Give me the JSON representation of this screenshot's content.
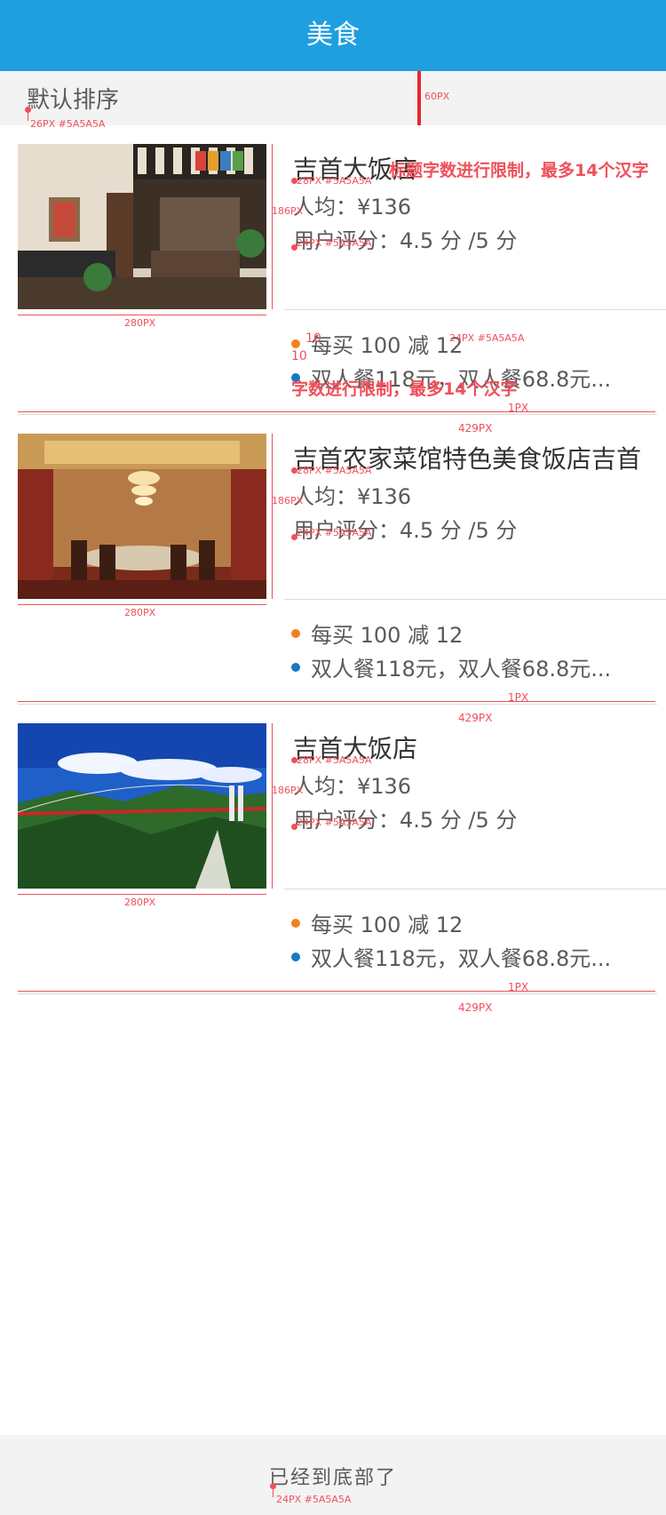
{
  "header": {
    "title": "美食"
  },
  "sort": {
    "label": "默认排序"
  },
  "annotations": {
    "sort_spec": "26PX #5A5A5A",
    "sortbar_height": "60PX",
    "title_limit_note": "标题字数进行限制，最多14个汉字",
    "promo_limit_note": "字数进行限制，最多14个汉字",
    "title_spec": "28PX #5A5A5A",
    "info_spec": "24PX #5A5A5A",
    "promo_spec": "24PX #5A5A5A",
    "image_height": "186PX",
    "image_width": "280PX",
    "line_width": "429PX",
    "line_thickness": "1PX",
    "gap_top": "10",
    "gap_bottom": "10",
    "footer_spec": "24PX #5A5A5A"
  },
  "colors": {
    "accent": "#1e9fe0",
    "promo_dot_1": "#f0821e",
    "promo_dot_2": "#1a78c2",
    "annotation": "#f0505a"
  },
  "restaurants": [
    {
      "name": "吉首大饭店",
      "avg_price": "人均：¥136",
      "rating": "用户评分：4.5 分 /5 分",
      "promo1": "每买 100 减 12",
      "promo2": "双人餐118元，双人餐68.8元...",
      "image": "restaurant-interior-photo"
    },
    {
      "name": "吉首农家菜馆特色美食饭店吉首",
      "avg_price": "人均：¥136",
      "rating": "用户评分：4.5 分 /5 分",
      "promo1": "每买 100 减 12",
      "promo2": "双人餐118元，双人餐68.8元...",
      "image": "private-dining-room-photo"
    },
    {
      "name": "吉首大饭店",
      "avg_price": "人均：¥136",
      "rating": "用户评分：4.5 分 /5 分",
      "promo1": "每买 100 减 12",
      "promo2": "双人餐118元，双人餐68.8元...",
      "image": "bridge-landscape-photo"
    }
  ],
  "footer": {
    "text": "已经到底部了"
  }
}
